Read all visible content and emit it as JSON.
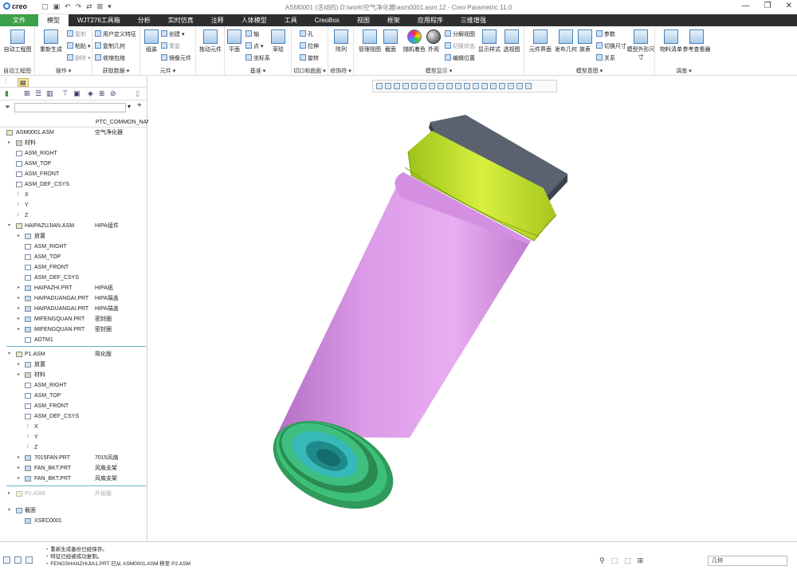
{
  "app": {
    "logo": "creo",
    "window_title": "ASM0001 (活动的) D:\\work\\空气净化器\\asm0001.asm.12 - Creo Parametric 11.0",
    "qat": [
      "▢",
      "▣",
      "↶",
      "↷",
      "⇄",
      "⊠",
      "▾"
    ],
    "window_controls": [
      "—",
      "❐",
      "✕"
    ]
  },
  "tabs": [
    "文件",
    "模型",
    "WJT276工具箱",
    "分析",
    "实时仿真",
    "注释",
    "人体模型",
    "工具",
    "CreoBox",
    "视图",
    "框架",
    "应用程序",
    "三维增强"
  ],
  "active_tab": "模型",
  "ribbon": {
    "groups": [
      {
        "label": "自动工程图",
        "items": [
          "自动工程图"
        ]
      },
      {
        "label": "操作 ▾",
        "items": [
          "重新生成",
          "复制",
          "粘贴 ▾",
          "删除 ▾"
        ]
      },
      {
        "label": "获取数据 ▾",
        "items": [
          "用户定义特征",
          "复制几何",
          "收缩包络"
        ]
      },
      {
        "label": "元件 ▾",
        "items": [
          "组装",
          "创建 ▾",
          "重复",
          "镜像元件"
        ]
      },
      {
        "label": "",
        "items": [
          "拖动元件"
        ]
      },
      {
        "label": "基准 ▾",
        "items": [
          "平面",
          "轴",
          "点 ▾",
          "坐标系",
          "草绘"
        ]
      },
      {
        "label": "切口和曲面 ▾",
        "items": [
          "孔",
          "拉伸",
          "旋转"
        ]
      },
      {
        "label": "修饰符 ▾",
        "items": [
          "阵列"
        ]
      },
      {
        "label": "模型显示 ▾",
        "items": [
          "管理视图",
          "截面",
          "随机着色",
          "外观",
          "分解视图",
          "切换状态",
          "编辑位置",
          "显示样式",
          "透视图"
        ]
      },
      {
        "label": "模型意图 ▾",
        "items": [
          "元件界面",
          "发布几何",
          "族表",
          "参数",
          "切换尺寸",
          "关系",
          "模型外形尺寸"
        ]
      },
      {
        "label": "调查 ▾",
        "items": [
          "物料清单",
          "参考查看器"
        ]
      }
    ]
  },
  "model_tree": {
    "filter_placeholder": "",
    "column_header": "PTC_COMMON_NAME",
    "rows": [
      {
        "name": "ASM0001.ASM",
        "value": "空气净化器"
      },
      {
        "name": "材料",
        "value": ""
      },
      {
        "name": "ASM_RIGHT",
        "value": ""
      },
      {
        "name": "ASM_TOP",
        "value": ""
      },
      {
        "name": "ASM_FRONT",
        "value": ""
      },
      {
        "name": "ASM_DEF_CSYS",
        "value": ""
      },
      {
        "name": "X",
        "value": ""
      },
      {
        "name": "Y",
        "value": ""
      },
      {
        "name": "Z",
        "value": ""
      },
      {
        "name": "HAIPAZUJIAN.ASM",
        "value": "HIPA组件"
      },
      {
        "name": "放置",
        "value": ""
      },
      {
        "name": "ASM_RIGHT",
        "value": ""
      },
      {
        "name": "ASM_TOP",
        "value": ""
      },
      {
        "name": "ASM_FRONT",
        "value": ""
      },
      {
        "name": "ASM_DEF_CSYS",
        "value": ""
      },
      {
        "name": "HAIPAZHI.PRT",
        "value": "HIPA纸"
      },
      {
        "name": "HAIPADUANGAI.PRT",
        "value": "HIPA端盖"
      },
      {
        "name": "HAIPADUANGAI.PRT",
        "value": "HIPA端盖"
      },
      {
        "name": "MIFENGQUAN.PRT",
        "value": "密封圈"
      },
      {
        "name": "MIFENGQUAN.PRT",
        "value": "密封圈"
      },
      {
        "name": "ADTM1",
        "value": ""
      },
      {
        "name": "P1.ASM",
        "value": "简化版"
      },
      {
        "name": "放置",
        "value": ""
      },
      {
        "name": "材料",
        "value": ""
      },
      {
        "name": "ASM_RIGHT",
        "value": ""
      },
      {
        "name": "ASM_TOP",
        "value": ""
      },
      {
        "name": "ASM_FRONT",
        "value": ""
      },
      {
        "name": "ASM_DEF_CSYS",
        "value": ""
      },
      {
        "name": "X",
        "value": ""
      },
      {
        "name": "Y",
        "value": ""
      },
      {
        "name": "Z",
        "value": ""
      },
      {
        "name": "7015FAN.PRT",
        "value": "7015风扇"
      },
      {
        "name": "FAN_BKT.PRT",
        "value": "风扇支架"
      },
      {
        "name": "FAN_BKT.PRT",
        "value": "风扇支架"
      },
      {
        "name": "P2.ASM",
        "value": "升级版"
      },
      {
        "name": "截面",
        "value": ""
      },
      {
        "name": "XSEC0001",
        "value": ""
      }
    ]
  },
  "status": {
    "messages": [
      "重新生成备份已经保存。",
      "特征已经被成功复制。",
      "FENGSHANZHIJIA1.PRT 已从 ASM0001.ASM 移至 P2.ASM"
    ],
    "filter_value": "几何"
  }
}
